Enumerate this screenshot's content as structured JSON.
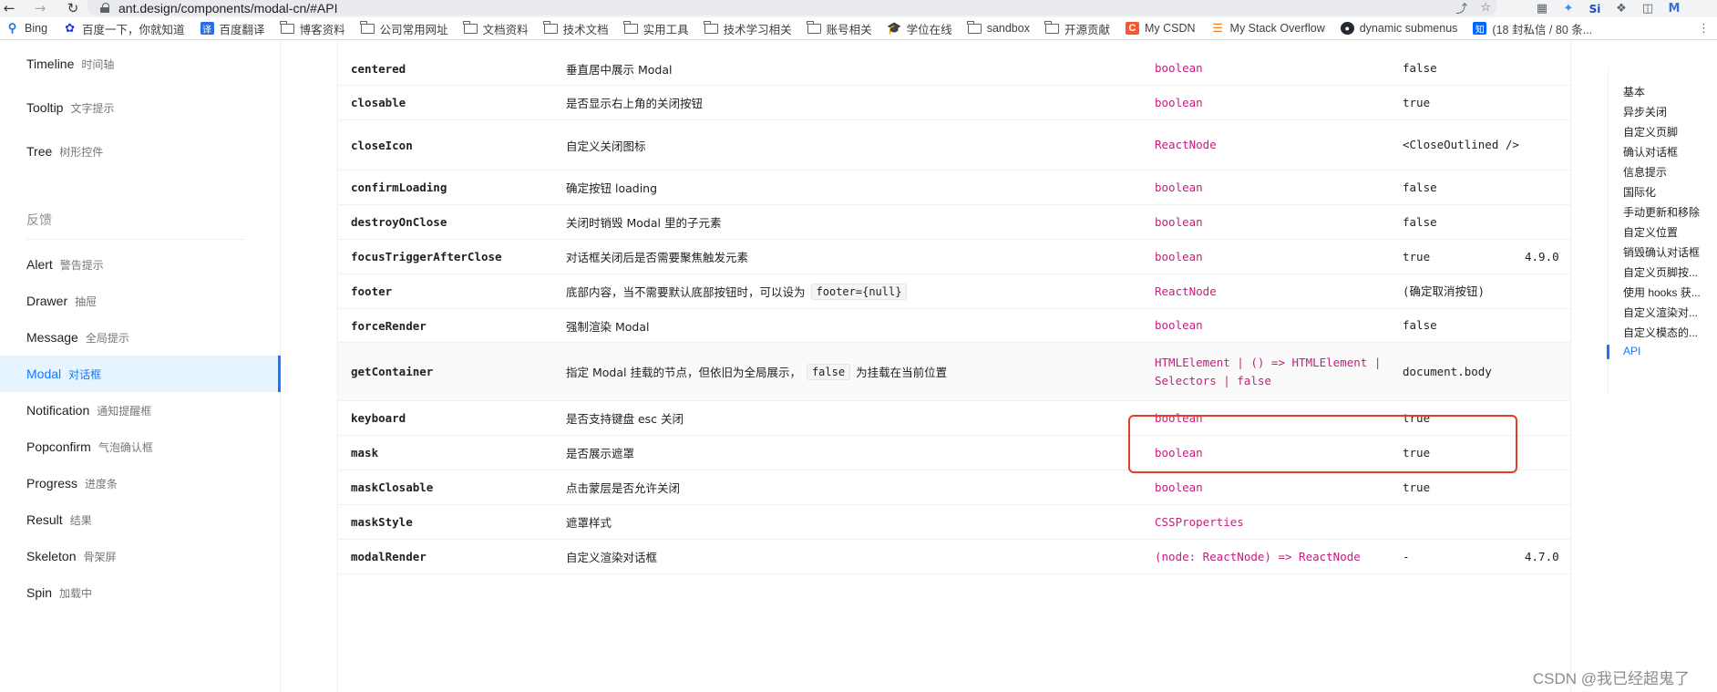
{
  "browser": {
    "url": "ant.design/components/modal-cn/#API",
    "bookmarks": [
      {
        "label": "Bing",
        "icon": "search-icon"
      },
      {
        "label": "百度一下，你就知道",
        "icon": "baidu-paw-icon"
      },
      {
        "label": "百度翻译",
        "icon": "translate-icon"
      },
      {
        "label": "博客资料",
        "icon": "folder-icon"
      },
      {
        "label": "公司常用网址",
        "icon": "folder-icon"
      },
      {
        "label": "文档资料",
        "icon": "folder-icon"
      },
      {
        "label": "技术文档",
        "icon": "folder-icon"
      },
      {
        "label": "实用工具",
        "icon": "folder-icon"
      },
      {
        "label": "技术学习相关",
        "icon": "folder-icon"
      },
      {
        "label": "账号相关",
        "icon": "folder-icon"
      },
      {
        "label": "学位在线",
        "icon": "graduation-cap-icon"
      },
      {
        "label": "sandbox",
        "icon": "folder-icon"
      },
      {
        "label": "开源贡献",
        "icon": "folder-icon"
      },
      {
        "label": "My CSDN",
        "icon": "csdn-icon"
      },
      {
        "label": "My Stack Overflow",
        "icon": "stackoverflow-icon"
      },
      {
        "label": "dynamic submenus",
        "icon": "github-icon"
      },
      {
        "label": "(18 封私信 / 80 条...",
        "icon": "zhihu-icon"
      }
    ]
  },
  "sidebar": {
    "items_top": [
      {
        "label": "Timeline",
        "sub": "时间轴"
      },
      {
        "label": "Tooltip",
        "sub": "文字提示"
      },
      {
        "label": "Tree",
        "sub": "树形控件"
      }
    ],
    "group_label": "反馈",
    "items": [
      {
        "label": "Alert",
        "sub": "警告提示"
      },
      {
        "label": "Drawer",
        "sub": "抽屉"
      },
      {
        "label": "Message",
        "sub": "全局提示"
      },
      {
        "label": "Modal",
        "sub": "对话框"
      },
      {
        "label": "Notification",
        "sub": "通知提醒框"
      },
      {
        "label": "Popconfirm",
        "sub": "气泡确认框"
      },
      {
        "label": "Progress",
        "sub": "进度条"
      },
      {
        "label": "Result",
        "sub": "结果"
      },
      {
        "label": "Skeleton",
        "sub": "骨架屏"
      },
      {
        "label": "Spin",
        "sub": "加载中"
      }
    ],
    "active_label": "Modal"
  },
  "api_table": {
    "rows": [
      {
        "prop": "centered",
        "desc": "垂直居中展示 Modal",
        "type": "boolean",
        "default": "false",
        "version": ""
      },
      {
        "prop": "closable",
        "desc": "是否显示右上角的关闭按钮",
        "type": "boolean",
        "default": "true",
        "version": ""
      },
      {
        "prop": "closeIcon",
        "desc": "自定义关闭图标",
        "type": "ReactNode",
        "default": "<CloseOutlined />",
        "version": ""
      },
      {
        "prop": "confirmLoading",
        "desc": "确定按钮 loading",
        "type": "boolean",
        "default": "false",
        "version": ""
      },
      {
        "prop": "destroyOnClose",
        "desc": "关闭时销毁 Modal 里的子元素",
        "type": "boolean",
        "default": "false",
        "version": ""
      },
      {
        "prop": "focusTriggerAfterClose",
        "desc": "对话框关闭后是否需要聚焦触发元素",
        "type": "boolean",
        "default": "true",
        "version": "4.9.0"
      },
      {
        "prop": "footer",
        "desc_before": "底部内容，当不需要默认底部按钮时，可以设为",
        "desc_code": "footer={null}",
        "desc_after": "",
        "type": "ReactNode",
        "default": "(确定取消按钮)",
        "version": ""
      },
      {
        "prop": "forceRender",
        "desc": "强制渲染 Modal",
        "type": "boolean",
        "default": "false",
        "version": ""
      },
      {
        "prop": "getContainer",
        "desc_before": "指定 Modal 挂载的节点，但依旧为全局展示，",
        "desc_code": "false",
        "desc_after": "为挂载在当前位置",
        "type": "HTMLElement | () => HTMLElement | Selectors | false",
        "default": "document.body",
        "version": ""
      },
      {
        "prop": "keyboard",
        "desc": "是否支持键盘 esc 关闭",
        "type": "boolean",
        "default": "true",
        "version": ""
      },
      {
        "prop": "mask",
        "desc": "是否展示遮罩",
        "type": "boolean",
        "default": "true",
        "version": ""
      },
      {
        "prop": "maskClosable",
        "desc": "点击蒙层是否允许关闭",
        "type": "boolean",
        "default": "true",
        "version": ""
      },
      {
        "prop": "maskStyle",
        "desc": "遮罩样式",
        "type": "CSSProperties",
        "default": "",
        "version": ""
      },
      {
        "prop": "modalRender",
        "desc": "自定义渲染对话框",
        "type": "(node: ReactNode) => ReactNode",
        "default": "-",
        "version": "4.7.0"
      }
    ]
  },
  "anchor": {
    "links": [
      "基本",
      "异步关闭",
      "自定义页脚",
      "确认对话框",
      "信息提示",
      "国际化",
      "手动更新和移除",
      "自定义位置",
      "销毁确认对话框",
      "自定义页脚按...",
      "使用 hooks 获...",
      "自定义渲染对...",
      "自定义模态的...",
      "API"
    ],
    "active": "API"
  },
  "watermark": "CSDN @我已经超鬼了",
  "colors": {
    "accent": "#1677ff",
    "type_text": "#c41d7f",
    "highlight_box": "#e63b2e"
  }
}
